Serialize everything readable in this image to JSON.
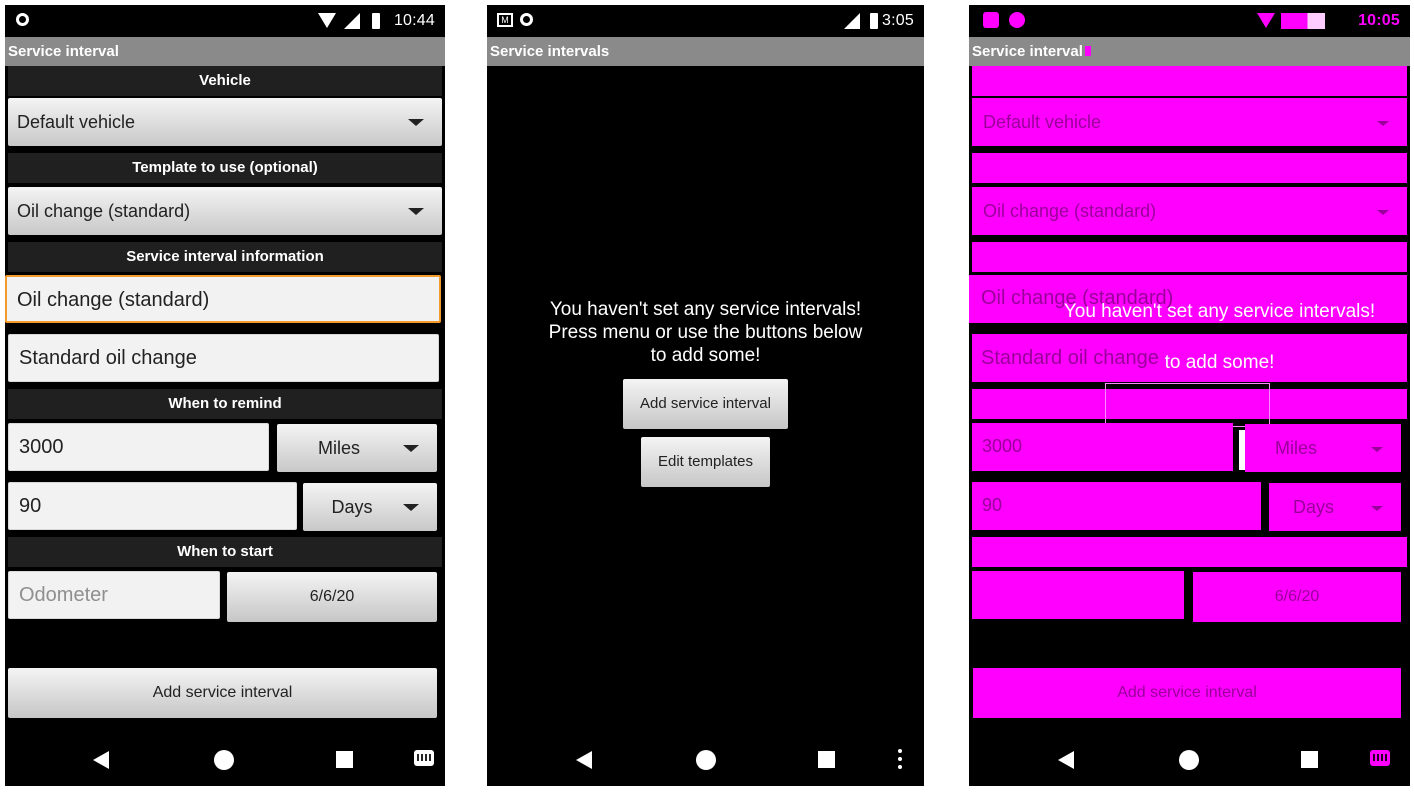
{
  "screen1": {
    "time": "10:44",
    "title": "Service interval",
    "sections": {
      "vehicle": "Vehicle",
      "template": "Template to use (optional)",
      "info": "Service interval information",
      "remind": "When to remind",
      "start": "When to start"
    },
    "vehicle_value": "Default vehicle",
    "template_value": "Oil change (standard)",
    "name_value": "Oil change (standard)",
    "description_value": "Standard oil change",
    "distance_value": "3000",
    "distance_unit": "Miles",
    "time_value": "90",
    "time_unit": "Days",
    "odometer_placeholder": "Odometer",
    "start_date": "6/6/20",
    "add_button": "Add service interval"
  },
  "screen2": {
    "time": "3:05",
    "title": "Service intervals",
    "empty_line1": "You haven't set any service intervals!",
    "empty_line2": "Press menu or use the buttons below",
    "empty_line3": "to add some!",
    "add_button": "Add service interval",
    "edit_button": "Edit templates"
  },
  "screen3": {
    "time": "10:05",
    "title": "Service interval",
    "vehicle_value": "Default vehicle",
    "template_value": "Oil change (standard)",
    "name_value": "Oil change (standard)",
    "description_value": "Standard oil change",
    "overlay_line1": "You haven't set any service intervals!",
    "overlay_line3": "to add some!",
    "distance_value": "3000",
    "distance_unit": "Miles",
    "time_value": "90",
    "time_unit": "Days",
    "start_date": "6/6/20",
    "add_button": "Add service interval"
  },
  "colors": {
    "title_bar": "#8a8a8a",
    "section_bar": "#202020",
    "focus_border": "#f39a2c",
    "magenta": "#ff00ff"
  }
}
